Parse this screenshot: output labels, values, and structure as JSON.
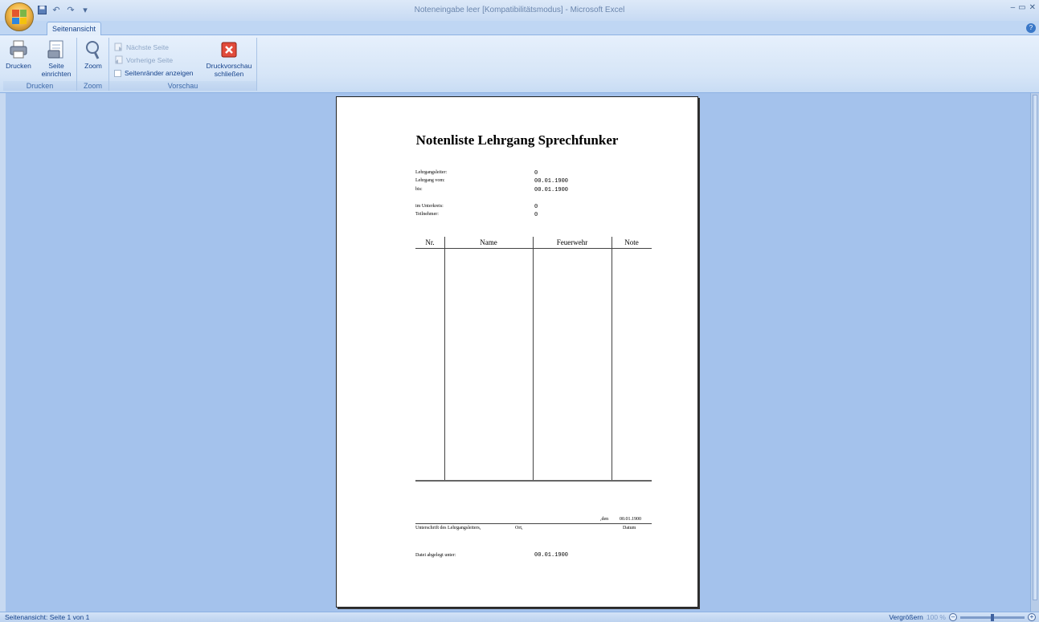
{
  "window": {
    "title": "Noteneingabe leer  [Kompatibilitätsmodus] - Microsoft Excel",
    "controls": [
      "–",
      "▭",
      "✕"
    ]
  },
  "ribbon": {
    "tab": "Seitenansicht",
    "groups": {
      "drucken": {
        "label": "Drucken",
        "print_label": "Drucken",
        "page_setup_line1": "Seite",
        "page_setup_line2": "einrichten"
      },
      "zoom": {
        "label": "Zoom",
        "zoom_label": "Zoom"
      },
      "vorschau": {
        "label": "Vorschau",
        "next_page": "Nächste Seite",
        "prev_page": "Vorherige Seite",
        "show_margins": "Seitenränder anzeigen",
        "close_line1": "Druckvorschau",
        "close_line2": "schließen"
      }
    }
  },
  "document": {
    "title": "Notenliste Lehrgang Sprechfunker",
    "fields": [
      {
        "label": "Lehrgangsleiter:",
        "value": "0"
      },
      {
        "label": "Lehrgang vom:",
        "value": "00.01.1900"
      },
      {
        "label": "bis:",
        "value": "00.01.1900"
      },
      {
        "label": "im Unterkreis:",
        "value": "0"
      },
      {
        "label": "Teilnehmer:",
        "value": "0"
      }
    ],
    "table_headers": [
      "Nr.",
      "Name",
      "Feuerwehr",
      "Note"
    ],
    "signature": {
      "den_label": ",den",
      "date_value": "00.01.1900",
      "caption_left": "Unterschrift des Lehrgangsleiters,",
      "caption_mid": "Ort,",
      "caption_right": "Datum"
    },
    "filed": {
      "label": "Datei abgelegt unter:",
      "value": "00.01.1900"
    }
  },
  "status": {
    "text": "Seitenansicht: Seite 1 von 1",
    "zoom_label": "Vergrößern",
    "zoom_value": "100 %"
  }
}
